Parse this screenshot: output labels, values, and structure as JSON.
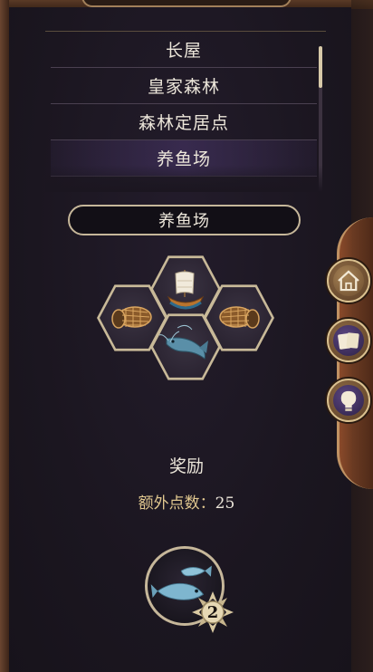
{
  "location_list": {
    "items": [
      {
        "label": "长屋",
        "selected": false
      },
      {
        "label": "皇家森林",
        "selected": false
      },
      {
        "label": "森林定居点",
        "selected": false
      },
      {
        "label": "养鱼场",
        "selected": true
      }
    ],
    "scroll_fraction": 0.75
  },
  "selected_name": "养鱼场",
  "tiles": [
    {
      "icon": "ship-icon",
      "position": "top"
    },
    {
      "icon": "fish-trap-icon",
      "position": "left"
    },
    {
      "icon": "fish-trap-icon",
      "position": "right"
    },
    {
      "icon": "catfish-icon",
      "position": "bottom"
    }
  ],
  "side_buttons": [
    {
      "icon": "house-icon"
    },
    {
      "icon": "cards-icon"
    },
    {
      "icon": "lightbulb-icon"
    }
  ],
  "reward": {
    "title": "奖励",
    "extra_points_label": "额外点数：",
    "extra_points_value": "25",
    "icon": "fish-icon",
    "badge_value": "2"
  },
  "colors": {
    "panel_bg": "#1b1620",
    "accent_gold": "#c6b79a",
    "wood": "#6a3a22",
    "button_purple": "#3d2e63"
  }
}
